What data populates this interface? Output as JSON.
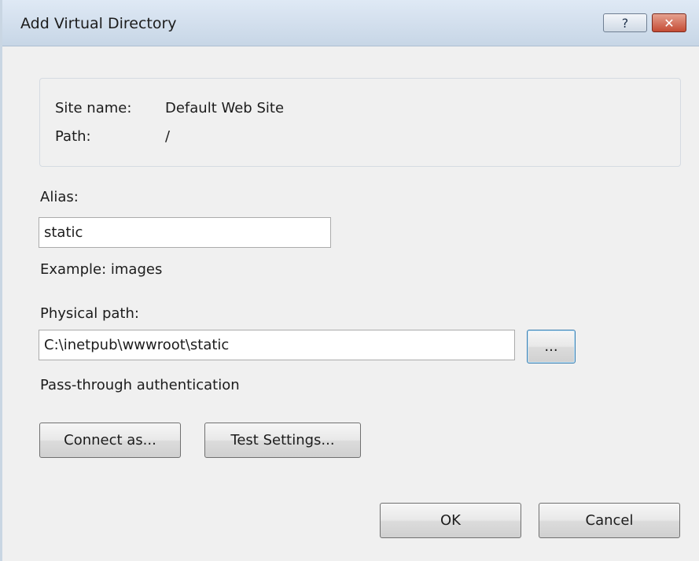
{
  "window": {
    "title": "Add Virtual Directory",
    "help_label": "?",
    "close_label": "✕"
  },
  "info": {
    "site_name_label": "Site name:",
    "site_name_value": "Default Web Site",
    "path_label": "Path:",
    "path_value": "/"
  },
  "alias": {
    "label": "Alias:",
    "value": "static",
    "example": "Example: images"
  },
  "physical_path": {
    "label": "Physical path:",
    "value": "C:\\inetpub\\wwwroot\\static",
    "browse_label": "..."
  },
  "auth": {
    "label": "Pass-through authentication",
    "connect_as_label": "Connect as...",
    "test_settings_label": "Test Settings..."
  },
  "actions": {
    "ok_label": "OK",
    "cancel_label": "Cancel"
  },
  "colors": {
    "dialog_background": "#f0f0f0",
    "titlebar": "#d3dfec",
    "close_button": "#c44b34"
  }
}
